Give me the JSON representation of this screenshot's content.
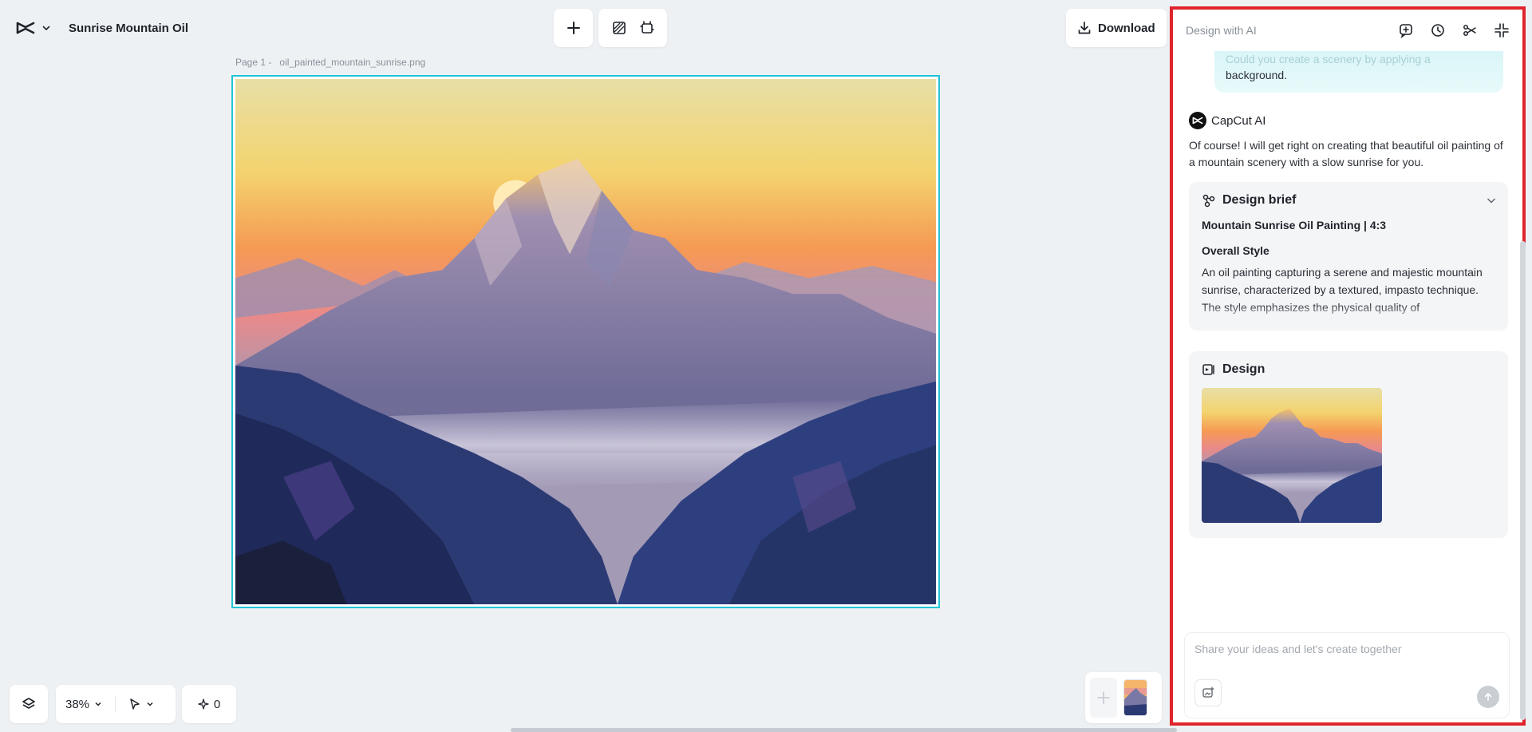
{
  "app": {
    "project_title": "Sunrise Mountain Oil",
    "download_label": "Download"
  },
  "canvas": {
    "page_label": "Page 1 -",
    "file_name": "oil_painted_mountain_sunrise.png",
    "selection_color": "#22c3d6"
  },
  "bottom_bar": {
    "zoom": "38%",
    "credits": "0"
  },
  "panel": {
    "title": "Design with AI",
    "border_color": "#e0242c",
    "user_message_partial": "Could you create a scenery by applying a",
    "user_message_tail": "background.",
    "ai_author": "CapCut AI",
    "ai_message": "Of course! I will get right on creating that beautiful oil painting of a mountain scenery with a slow sunrise for you.",
    "brief": {
      "title": "Design brief",
      "heading": "Mountain Sunrise Oil Painting | 4:3",
      "style_title": "Overall Style",
      "style_text": "An oil painting capturing a serene and majestic mountain sunrise, characterized by a textured, impasto technique. The style emphasizes the physical quality of"
    },
    "design": {
      "title": "Design"
    },
    "composer": {
      "placeholder": "Share your ideas and let's create together"
    }
  },
  "icons": {
    "logo": "capcut-logo-icon",
    "layers": "layers-icon",
    "cursor": "pointer-icon",
    "sparkle": "sparkle-icon",
    "add": "plus-icon",
    "remove_bg": "remove-background-icon",
    "resize": "resize-icon",
    "download": "download-icon",
    "new_chat": "new-chat-icon",
    "history": "history-icon",
    "share": "share-icon",
    "collapse": "collapse-icon"
  }
}
